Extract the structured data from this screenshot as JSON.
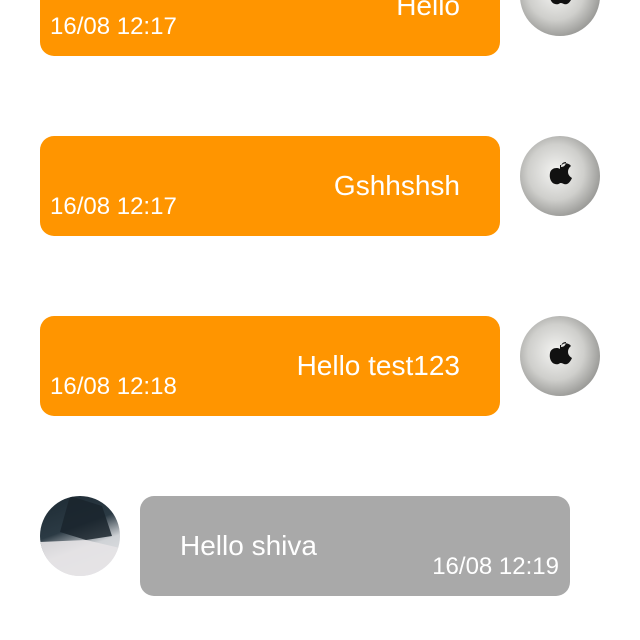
{
  "messages": [
    {
      "direction": "outgoing",
      "text": "Hello",
      "time": "16/08 12:17",
      "avatar_icon": "apple-logo-icon"
    },
    {
      "direction": "outgoing",
      "text": "Gshhshsh",
      "time": "16/08 12:17",
      "avatar_icon": "apple-logo-icon"
    },
    {
      "direction": "outgoing",
      "text": "Hello test123",
      "time": "16/08 12:18",
      "avatar_icon": "apple-logo-icon"
    },
    {
      "direction": "incoming",
      "text": "Hello shiva",
      "time": "16/08 12:19",
      "avatar_icon": "user-photo-icon"
    }
  ],
  "colors": {
    "outgoing_bubble": "#ff9500",
    "incoming_bubble": "#a9a9a9",
    "bubble_text": "#ffffff",
    "background": "#ffffff"
  }
}
